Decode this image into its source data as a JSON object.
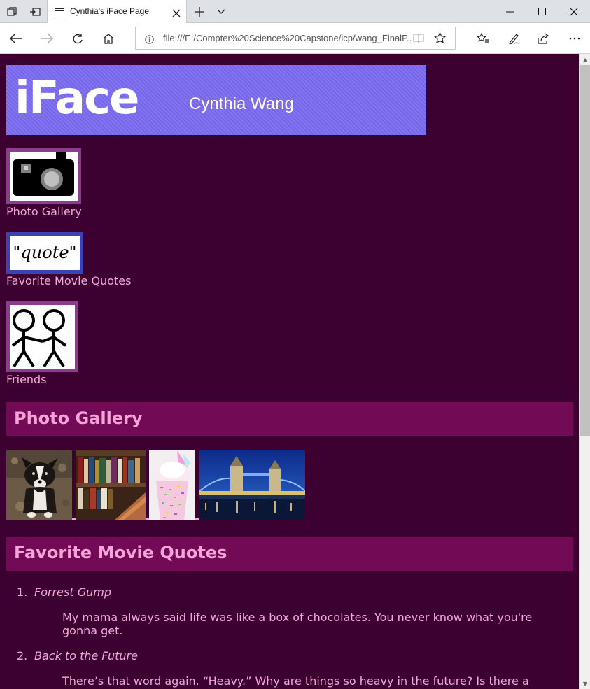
{
  "browser": {
    "tab_title": "Cynthia's iFace Page",
    "url": "file:///E:/Compter%20Science%20Capstone/icp/wang_FinalP..."
  },
  "header": {
    "logo": "iFace",
    "owner": "Cynthia Wang"
  },
  "nav_links": [
    {
      "label": "Photo Gallery",
      "icon": "camera-icon"
    },
    {
      "label": "Favorite Movie Quotes",
      "icon": "quote-icon"
    },
    {
      "label": "Friends",
      "icon": "stick-figures-icon"
    }
  ],
  "sections": {
    "gallery_title": "Photo Gallery",
    "quotes_title": "Favorite Movie Quotes"
  },
  "gallery": [
    "puppy-photo",
    "bookshelf-photo",
    "sprinkle-shake-photo",
    "tower-bridge-photo"
  ],
  "quotes": [
    {
      "num": "1.",
      "movie": "Forrest Gump",
      "line1": "My mama always said life was like a box of chocolates. You never know what you're",
      "line2": "gonna get."
    },
    {
      "num": "2.",
      "movie": "Back to the Future",
      "line1": "There’s that word again. “Heavy.” Why are things so heavy in the future? Is there a",
      "line2": ""
    }
  ],
  "colors": {
    "page_bg": "#3d0131",
    "section_bg": "#720a56",
    "link_text": "#f2a7d5",
    "banner": "#7b6cf2"
  }
}
